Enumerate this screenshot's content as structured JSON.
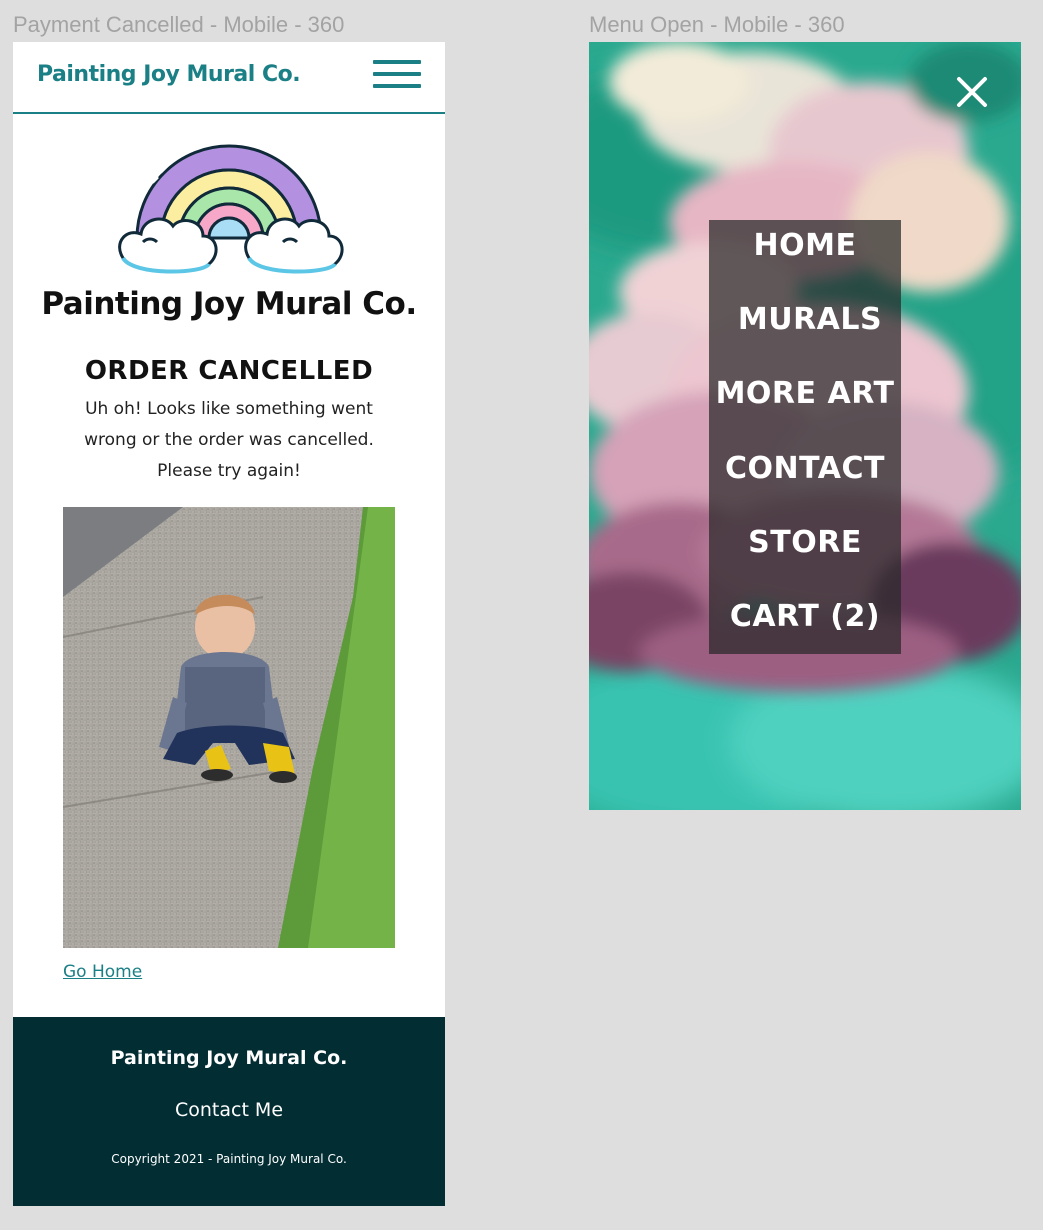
{
  "frames": {
    "left_label": "Payment Cancelled - Mobile - 360",
    "right_label": "Menu Open - Mobile - 360"
  },
  "header": {
    "brand": "Painting Joy Mural Co.",
    "menu_icon": "hamburger-icon"
  },
  "main": {
    "logo_icon": "rainbow-cloud-logo",
    "title": "Painting Joy Mural Co.",
    "order_heading": "ORDER CANCELLED",
    "order_message": "Uh oh! Looks like something went wrong or the order was cancelled. Please try again!",
    "photo_icon": "child-sitting-on-sidewalk-photo",
    "go_home_link": "Go Home"
  },
  "footer": {
    "brand": "Painting Joy Mural Co.",
    "contact_link": "Contact Me",
    "copyright": "Copyright 2021 - Painting Joy Mural Co."
  },
  "menu": {
    "close_icon": "close-icon",
    "items": [
      {
        "label": "HOME"
      },
      {
        "label": "MURALS"
      },
      {
        "label": "MORE ART"
      },
      {
        "label": "CONTACT"
      },
      {
        "label": "STORE"
      },
      {
        "label": "CART (2)"
      }
    ]
  },
  "colors": {
    "brand_teal": "#1b7f86",
    "footer_bg": "#022d33",
    "canvas_bg": "#dedede"
  }
}
